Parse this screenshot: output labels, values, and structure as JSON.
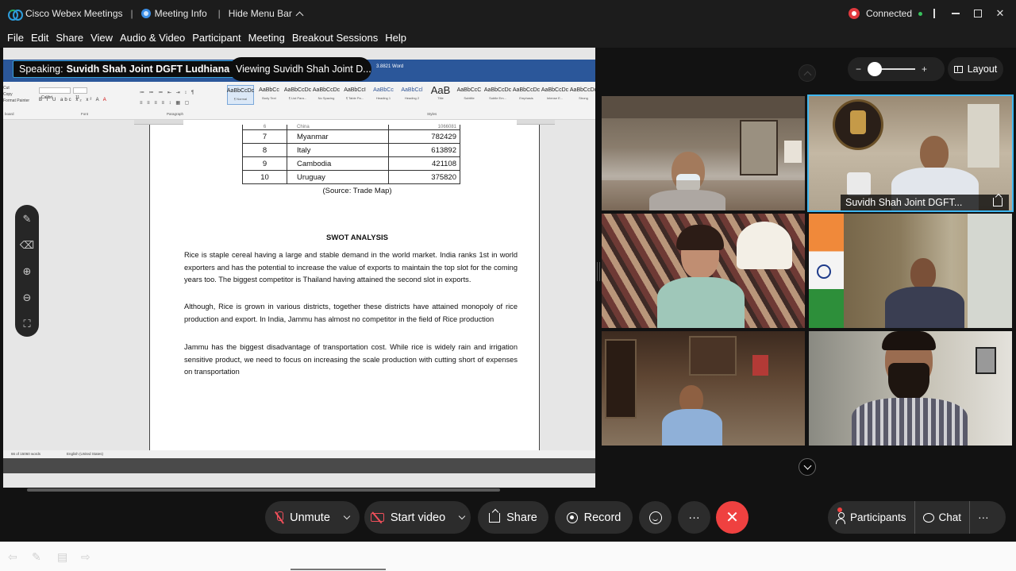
{
  "titlebar": {
    "app_name": "Cisco Webex Meetings",
    "sep1": "|",
    "meeting_info": "Meeting Info",
    "sep2": "|",
    "hide_menu": "Hide Menu Bar",
    "status": "Connected",
    "sep3": "|",
    "minimize": "",
    "maximize": "",
    "close": "✕"
  },
  "menubar": {
    "items": [
      "File",
      "Edit",
      "Share",
      "View",
      "Audio & Video",
      "Participant",
      "Meeting",
      "Breakout Sessions",
      "Help"
    ]
  },
  "overlay": {
    "speaking_label": "Speaking:",
    "speaking_name": "Suvidh Shah Joint DGFT Ludhiana",
    "viewing": "Viewing Suvidh Shah Joint D..."
  },
  "word": {
    "window_title": "3.8821  Word",
    "font_name": "Calibri",
    "font_size": "11",
    "styles": [
      {
        "sample": "AaBbCcDc",
        "label": "¶ Normal"
      },
      {
        "sample": "AaBbCc",
        "label": "Body Text"
      },
      {
        "sample": "AaBbCcDc",
        "label": "¶ List Para..."
      },
      {
        "sample": "AaBbCcDc",
        "label": "No Spacing"
      },
      {
        "sample": "AaBbCcI",
        "label": "¶ Table Pa..."
      },
      {
        "sample": "AaBbCc",
        "label": "Heading 1"
      },
      {
        "sample": "AaBbCcl",
        "label": "Heading 2"
      },
      {
        "sample": "AaB",
        "label": "Title"
      },
      {
        "sample": "AaBbCcC",
        "label": "Subtitle"
      },
      {
        "sample": "AaBbCcDc",
        "label": "Subtle Em..."
      },
      {
        "sample": "AaBbCcDc",
        "label": "Emphasis"
      },
      {
        "sample": "AaBbCcDc",
        "label": "Intense E..."
      },
      {
        "sample": "AaBbCcDc",
        "label": "Strong"
      }
    ],
    "groups": {
      "clipboard": "board",
      "font": "Font",
      "paragraph": "Paragraph",
      "styles": "Styles"
    },
    "pane_left": [
      "Cut",
      "Copy",
      "Format Painter"
    ],
    "table_partial": {
      "rank": "6",
      "country": "China",
      "value": "1066081"
    },
    "table_rows": [
      {
        "rank": "7",
        "country": "Myanmar",
        "value": "782429"
      },
      {
        "rank": "8",
        "country": "Italy",
        "value": "613892"
      },
      {
        "rank": "9",
        "country": "Cambodia",
        "value": "421108"
      },
      {
        "rank": "10",
        "country": "Uruguay",
        "value": "375820"
      }
    ],
    "source": "(Source: Trade Map)",
    "swot_title": "SWOT ANALYSIS",
    "paragraphs": [
      "Rice is staple cereal having a large and stable demand in the world market. India ranks 1st in world exporters and has the potential to increase the value of exports to maintain the top slot for the coming years too. The biggest competitor is Thailand having attained the second slot in exports.",
      "Although, Rice is grown in various districts, together these districts have attained monopoly of rice production and export. In India, Jammu has almost no competitor in the field of Rice production",
      "Jammu has the biggest disadvantage of transportation cost. While rice is widely rain and irrigation sensitive product, we need to focus on increasing the scale production with cutting short of expenses on transportation"
    ],
    "status_words": "66 of 15060 words",
    "status_lang": "English (United States)"
  },
  "annotation_tools": [
    "✎",
    "⌫",
    "⊕",
    "⊖",
    "⛶"
  ],
  "layout_button": "Layout",
  "zoom": {
    "minus": "−",
    "plus": "+",
    "level": 0.15
  },
  "tiles": [
    {
      "id": "tile-1",
      "name": ""
    },
    {
      "id": "tile-2",
      "name": "Suvidh Shah Joint DGFT..."
    },
    {
      "id": "tile-3",
      "name": ""
    },
    {
      "id": "tile-4",
      "name": ""
    },
    {
      "id": "tile-5",
      "name": ""
    },
    {
      "id": "tile-6",
      "name": ""
    }
  ],
  "controls": {
    "unmute": "Unmute",
    "start_video": "Start video",
    "share": "Share",
    "record": "Record",
    "more": "···",
    "end": "✕",
    "participants": "Participants",
    "chat": "Chat",
    "more_right": "···"
  },
  "colors": {
    "accent": "#3fb7f0",
    "end_call": "#ef4140",
    "muted": "#ef4f5a",
    "word_blue": "#2b579a",
    "connected_dot": "#38c15c"
  }
}
